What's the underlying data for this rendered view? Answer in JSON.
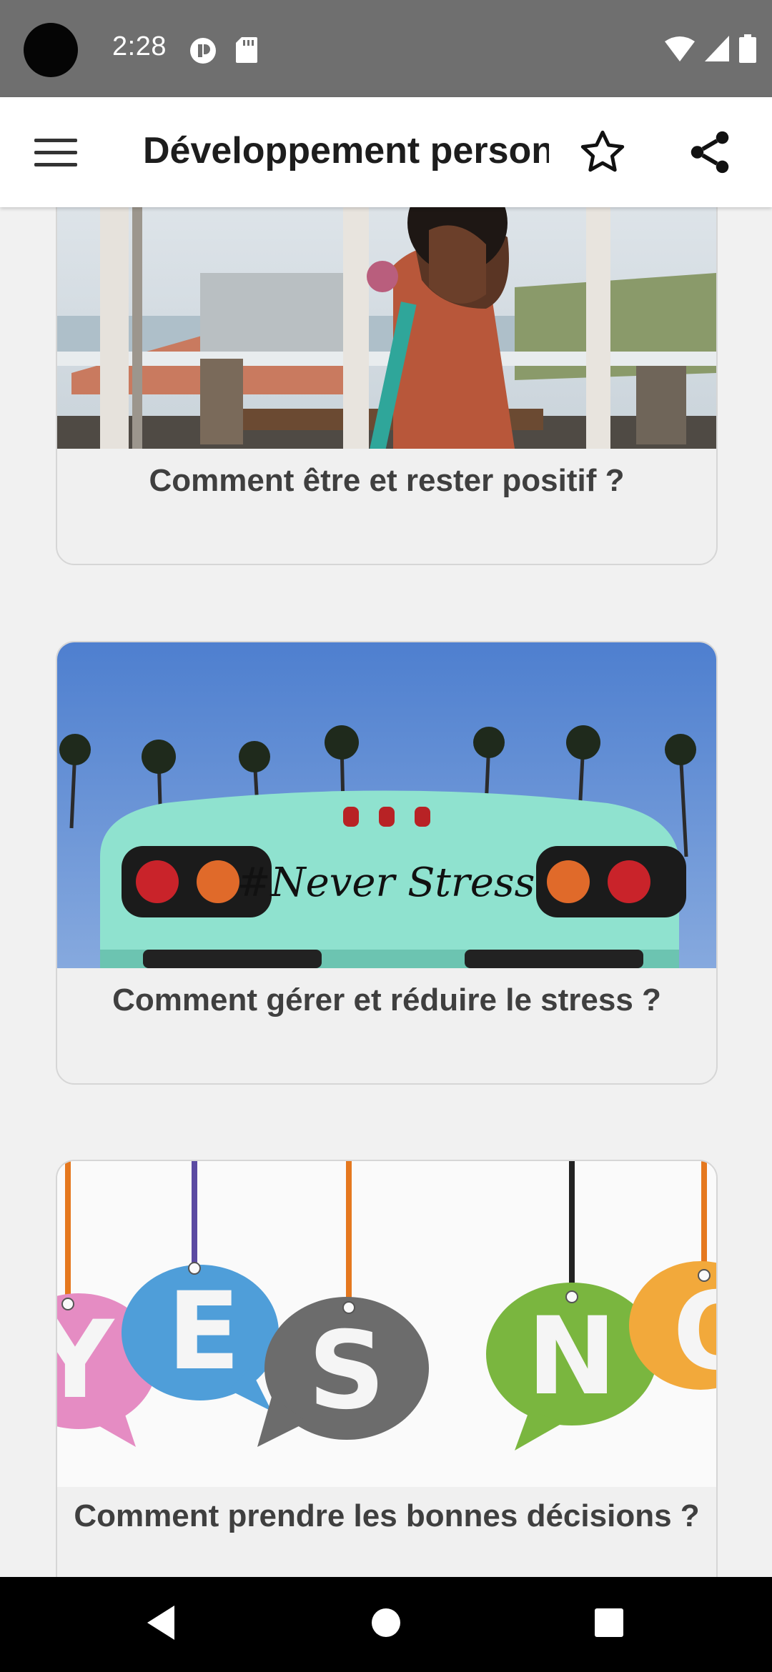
{
  "status_bar": {
    "time": "2:28",
    "icons": [
      "camera-cutout",
      "notification-icon",
      "sd-card-icon",
      "wifi-icon",
      "signal-icon",
      "battery-icon"
    ]
  },
  "app_bar": {
    "title": "Développement personnel",
    "icons": [
      "menu-icon",
      "star-icon",
      "share-icon"
    ]
  },
  "cards": [
    {
      "title": "Comment être et rester positif ?",
      "image": "woman-singing-photo"
    },
    {
      "title": "Comment gérer et réduire le stress ?",
      "image": "never-stress-bus-photo",
      "image_text": "#Never Stress"
    },
    {
      "title": "Comment prendre les bonnes décisions ?",
      "image": "yes-no-speech-bubbles",
      "image_text": "YES NO"
    }
  ],
  "nav_bar": {
    "icons": [
      "back-icon",
      "home-icon",
      "recents-icon"
    ]
  }
}
